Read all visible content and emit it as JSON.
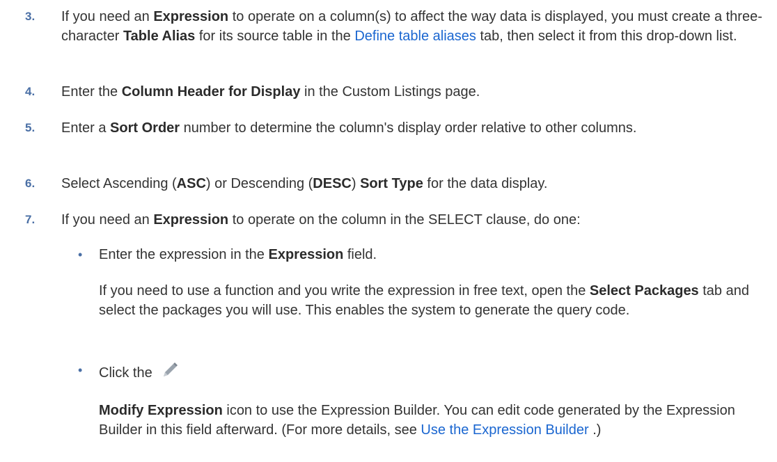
{
  "steps": [
    {
      "num": "3.",
      "parts": [
        "If you need an ",
        "Expression",
        " to operate on a column(s) to affect the way data is displayed, you must create a three-character ",
        "Table Alias",
        " for its source table in the ",
        "Define table aliases",
        " tab, then select it from this drop-down list."
      ]
    },
    {
      "num": "4.",
      "parts": [
        "Enter the ",
        "Column Header for Display",
        " in the Custom Listings page."
      ]
    },
    {
      "num": "5.",
      "parts": [
        "Enter a ",
        "Sort Order",
        " number to determine the column's display order relative to other columns."
      ]
    },
    {
      "num": "6.",
      "parts": [
        "Select Ascending (",
        "ASC",
        ") or Descending (",
        "DESC",
        ") ",
        "Sort Type",
        " for the data display."
      ]
    },
    {
      "num": "7.",
      "parts": [
        "If you need an ",
        "Expression",
        " to operate on the column in the SELECT clause, do one:"
      ]
    }
  ],
  "bullets": [
    {
      "marker": "•",
      "parts": [
        "Enter the expression in the ",
        "Expression",
        " field."
      ],
      "para": [
        "If you need to use a function and you write the expression in free text, open the ",
        "Select Packages",
        " tab and select the packages you will use. This enables the system to generate the query code."
      ]
    },
    {
      "marker": "•",
      "parts": [
        "Click the "
      ],
      "icon": "pencil-icon",
      "para": [
        "Modify Expression",
        " icon to use the Expression Builder. You can edit code generated by the Expression Builder in this field afterward. (For more details, see ",
        "Use the Expression Builder",
        " .)"
      ]
    }
  ]
}
